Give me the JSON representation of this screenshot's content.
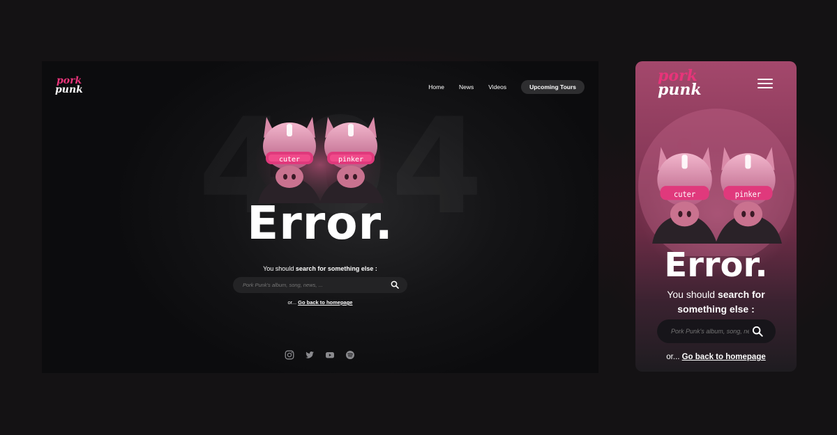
{
  "brand": {
    "logo_line1": "pork",
    "logo_line2": "punk"
  },
  "nav": {
    "items": [
      {
        "label": "Home"
      },
      {
        "label": "News"
      },
      {
        "label": "Videos"
      }
    ],
    "cta_label": "Upcoming Tours"
  },
  "hero": {
    "ghost_text": "404",
    "visor_left": "cuter",
    "visor_right": "pinker"
  },
  "error": {
    "title": "Error.",
    "prompt_prefix": "You should ",
    "prompt_bold": "search for something else :",
    "back_prefix": "or... ",
    "back_link": "Go back to homepage"
  },
  "search": {
    "placeholder": "Pork Punk's album, song, news, ..."
  },
  "social": [
    "instagram-icon",
    "twitter-icon",
    "youtube-icon",
    "spotify-icon"
  ],
  "colors": {
    "accent": "#e8347a",
    "background": "#141214"
  }
}
